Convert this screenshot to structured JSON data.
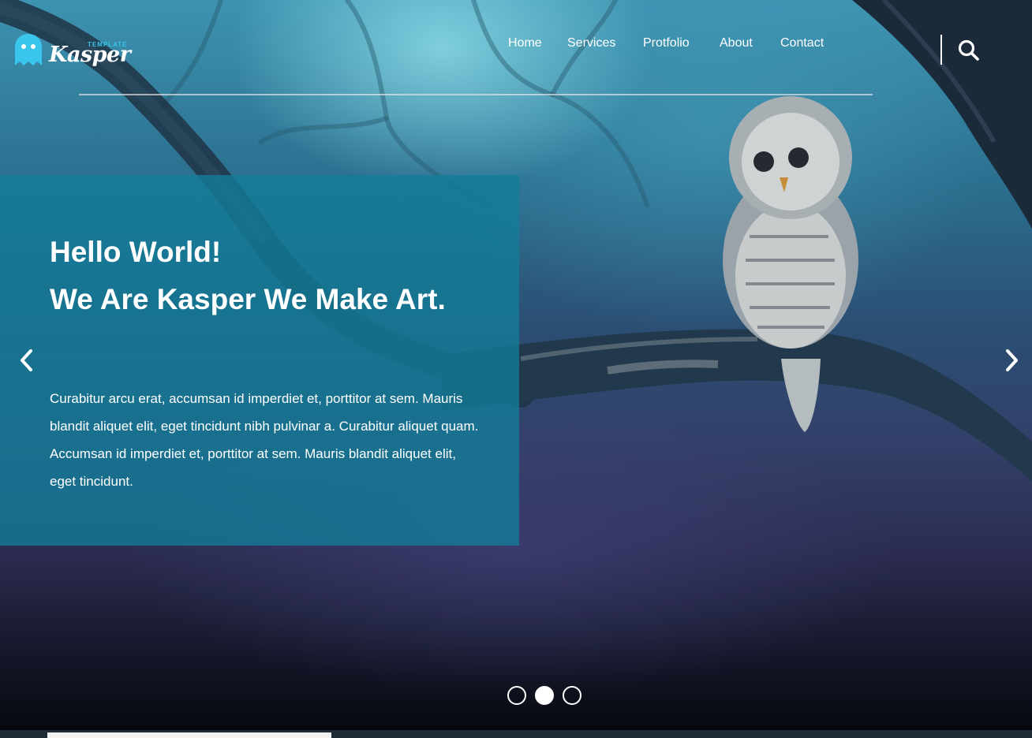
{
  "brand": {
    "name": "Kasper",
    "tag": "TEMPLATE",
    "accent_color": "#39c5ec",
    "logo_icon": "ghost-icon"
  },
  "nav": {
    "items": [
      {
        "label": "Home"
      },
      {
        "label": "Services"
      },
      {
        "label": "Protfolio"
      },
      {
        "label": "About"
      },
      {
        "label": "Contact"
      }
    ],
    "search_icon": "search-icon"
  },
  "hero": {
    "heading_line1": "Hello World!",
    "heading_line2": "We Are Kasper We Make Art.",
    "paragraph": "Curabitur arcu erat, accumsan id imperdiet et, porttitor at sem. Mauris blandit aliquet elit, eget tincidunt nibh pulvinar a. Curabitur aliquet quam. Accumsan id imperdiet et, porttitor at sem. Mauris blandit aliquet elit, eget tincidunt.",
    "caption_color": "#127e98",
    "prev_icon": "chevron-left-icon",
    "next_icon": "chevron-right-icon"
  },
  "slider": {
    "total_slides": 3,
    "active_slide": 2
  }
}
